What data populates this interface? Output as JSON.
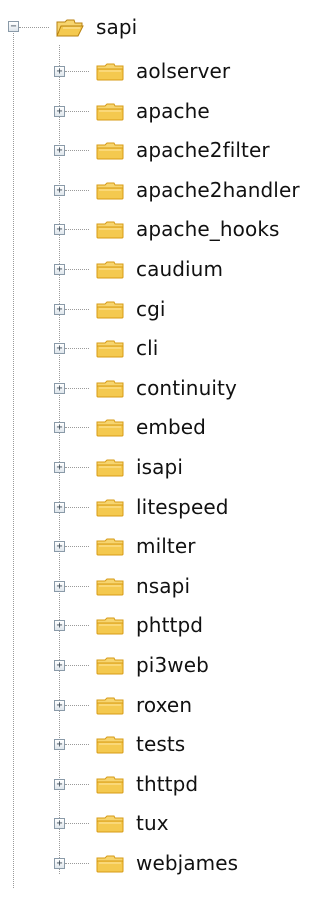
{
  "tree": {
    "root": {
      "label": "sapi",
      "expander": "−",
      "icon": "open-folder-icon",
      "expanded": true
    },
    "items": [
      {
        "label": "aolserver",
        "expander": "+",
        "icon": "folder-icon"
      },
      {
        "label": "apache",
        "expander": "+",
        "icon": "folder-icon"
      },
      {
        "label": "apache2filter",
        "expander": "+",
        "icon": "folder-icon"
      },
      {
        "label": "apache2handler",
        "expander": "+",
        "icon": "folder-icon"
      },
      {
        "label": "apache_hooks",
        "expander": "+",
        "icon": "folder-icon"
      },
      {
        "label": "caudium",
        "expander": "+",
        "icon": "folder-icon"
      },
      {
        "label": "cgi",
        "expander": "+",
        "icon": "folder-icon"
      },
      {
        "label": "cli",
        "expander": "+",
        "icon": "folder-icon"
      },
      {
        "label": "continuity",
        "expander": "+",
        "icon": "folder-icon"
      },
      {
        "label": "embed",
        "expander": "+",
        "icon": "folder-icon"
      },
      {
        "label": "isapi",
        "expander": "+",
        "icon": "folder-icon"
      },
      {
        "label": "litespeed",
        "expander": "+",
        "icon": "folder-icon"
      },
      {
        "label": "milter",
        "expander": "+",
        "icon": "folder-icon"
      },
      {
        "label": "nsapi",
        "expander": "+",
        "icon": "folder-icon"
      },
      {
        "label": "phttpd",
        "expander": "+",
        "icon": "folder-icon"
      },
      {
        "label": "pi3web",
        "expander": "+",
        "icon": "folder-icon"
      },
      {
        "label": "roxen",
        "expander": "+",
        "icon": "folder-icon"
      },
      {
        "label": "tests",
        "expander": "+",
        "icon": "folder-icon"
      },
      {
        "label": "thttpd",
        "expander": "+",
        "icon": "folder-icon"
      },
      {
        "label": "tux",
        "expander": "+",
        "icon": "folder-icon"
      },
      {
        "label": "webjames",
        "expander": "+",
        "icon": "folder-icon"
      }
    ]
  },
  "colors": {
    "folder_fill": "#f4c94f",
    "folder_dark": "#d79b16",
    "folder_tab": "#f7d56f",
    "guide_line": "#9a9a9a"
  }
}
